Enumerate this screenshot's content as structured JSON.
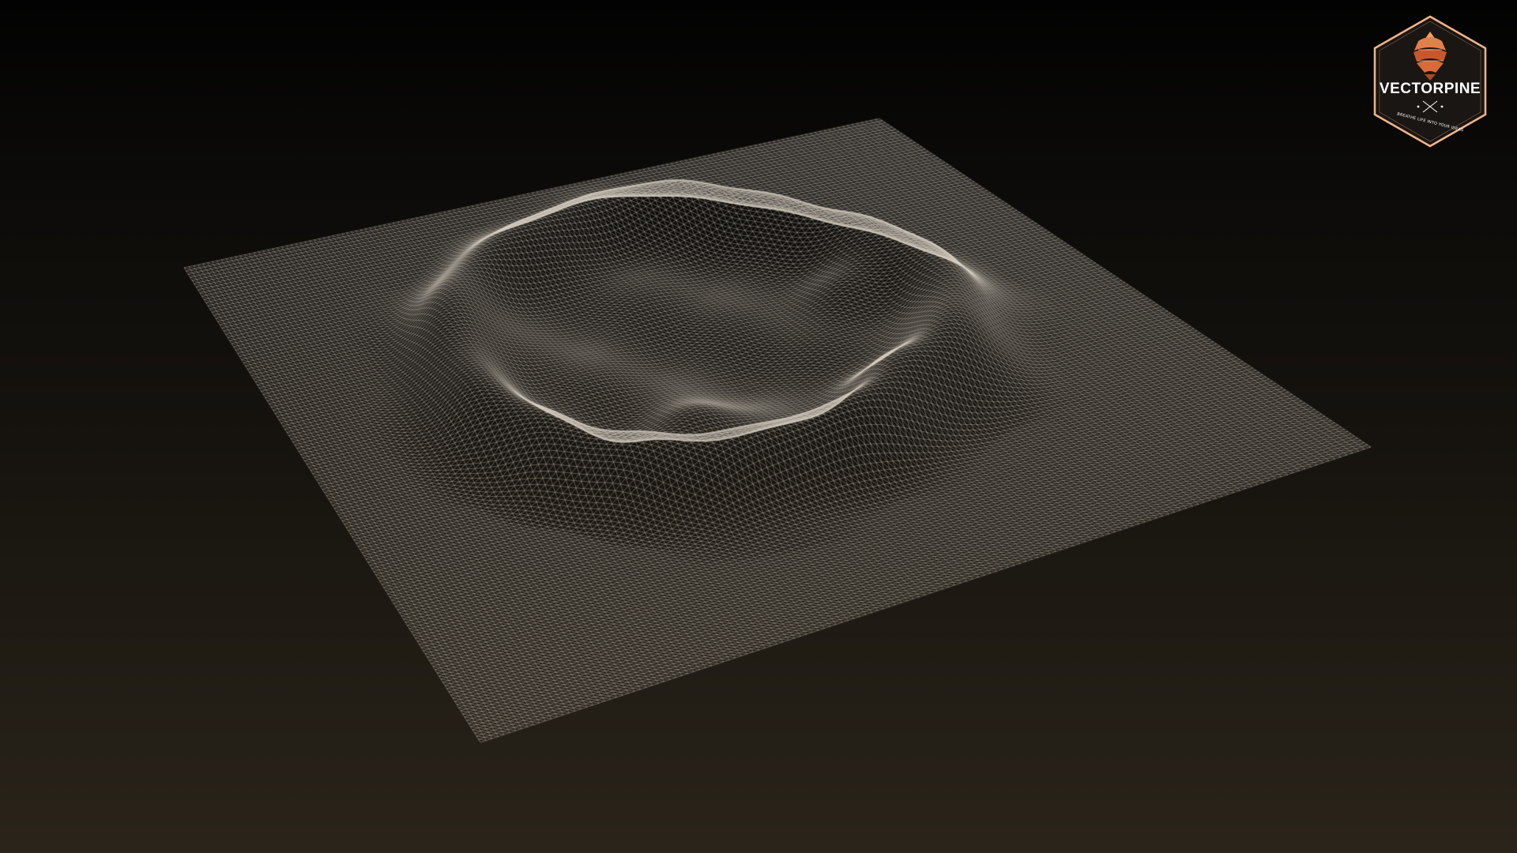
{
  "scene": {
    "background_top": "#020202",
    "background_bottom": "#2a241a",
    "wireframe_color": "#d9d2c4",
    "object": "terrain-wireframe-mesh"
  },
  "logo": {
    "brand": "VECTORPINE",
    "tagline": "BREATHE LIFE INTO YOUR IDEAS",
    "border_color": "#f0b48a",
    "accent_colors": [
      "#e0804a",
      "#c8582c",
      "#f2a060"
    ],
    "icon": "pinecone-icon"
  }
}
